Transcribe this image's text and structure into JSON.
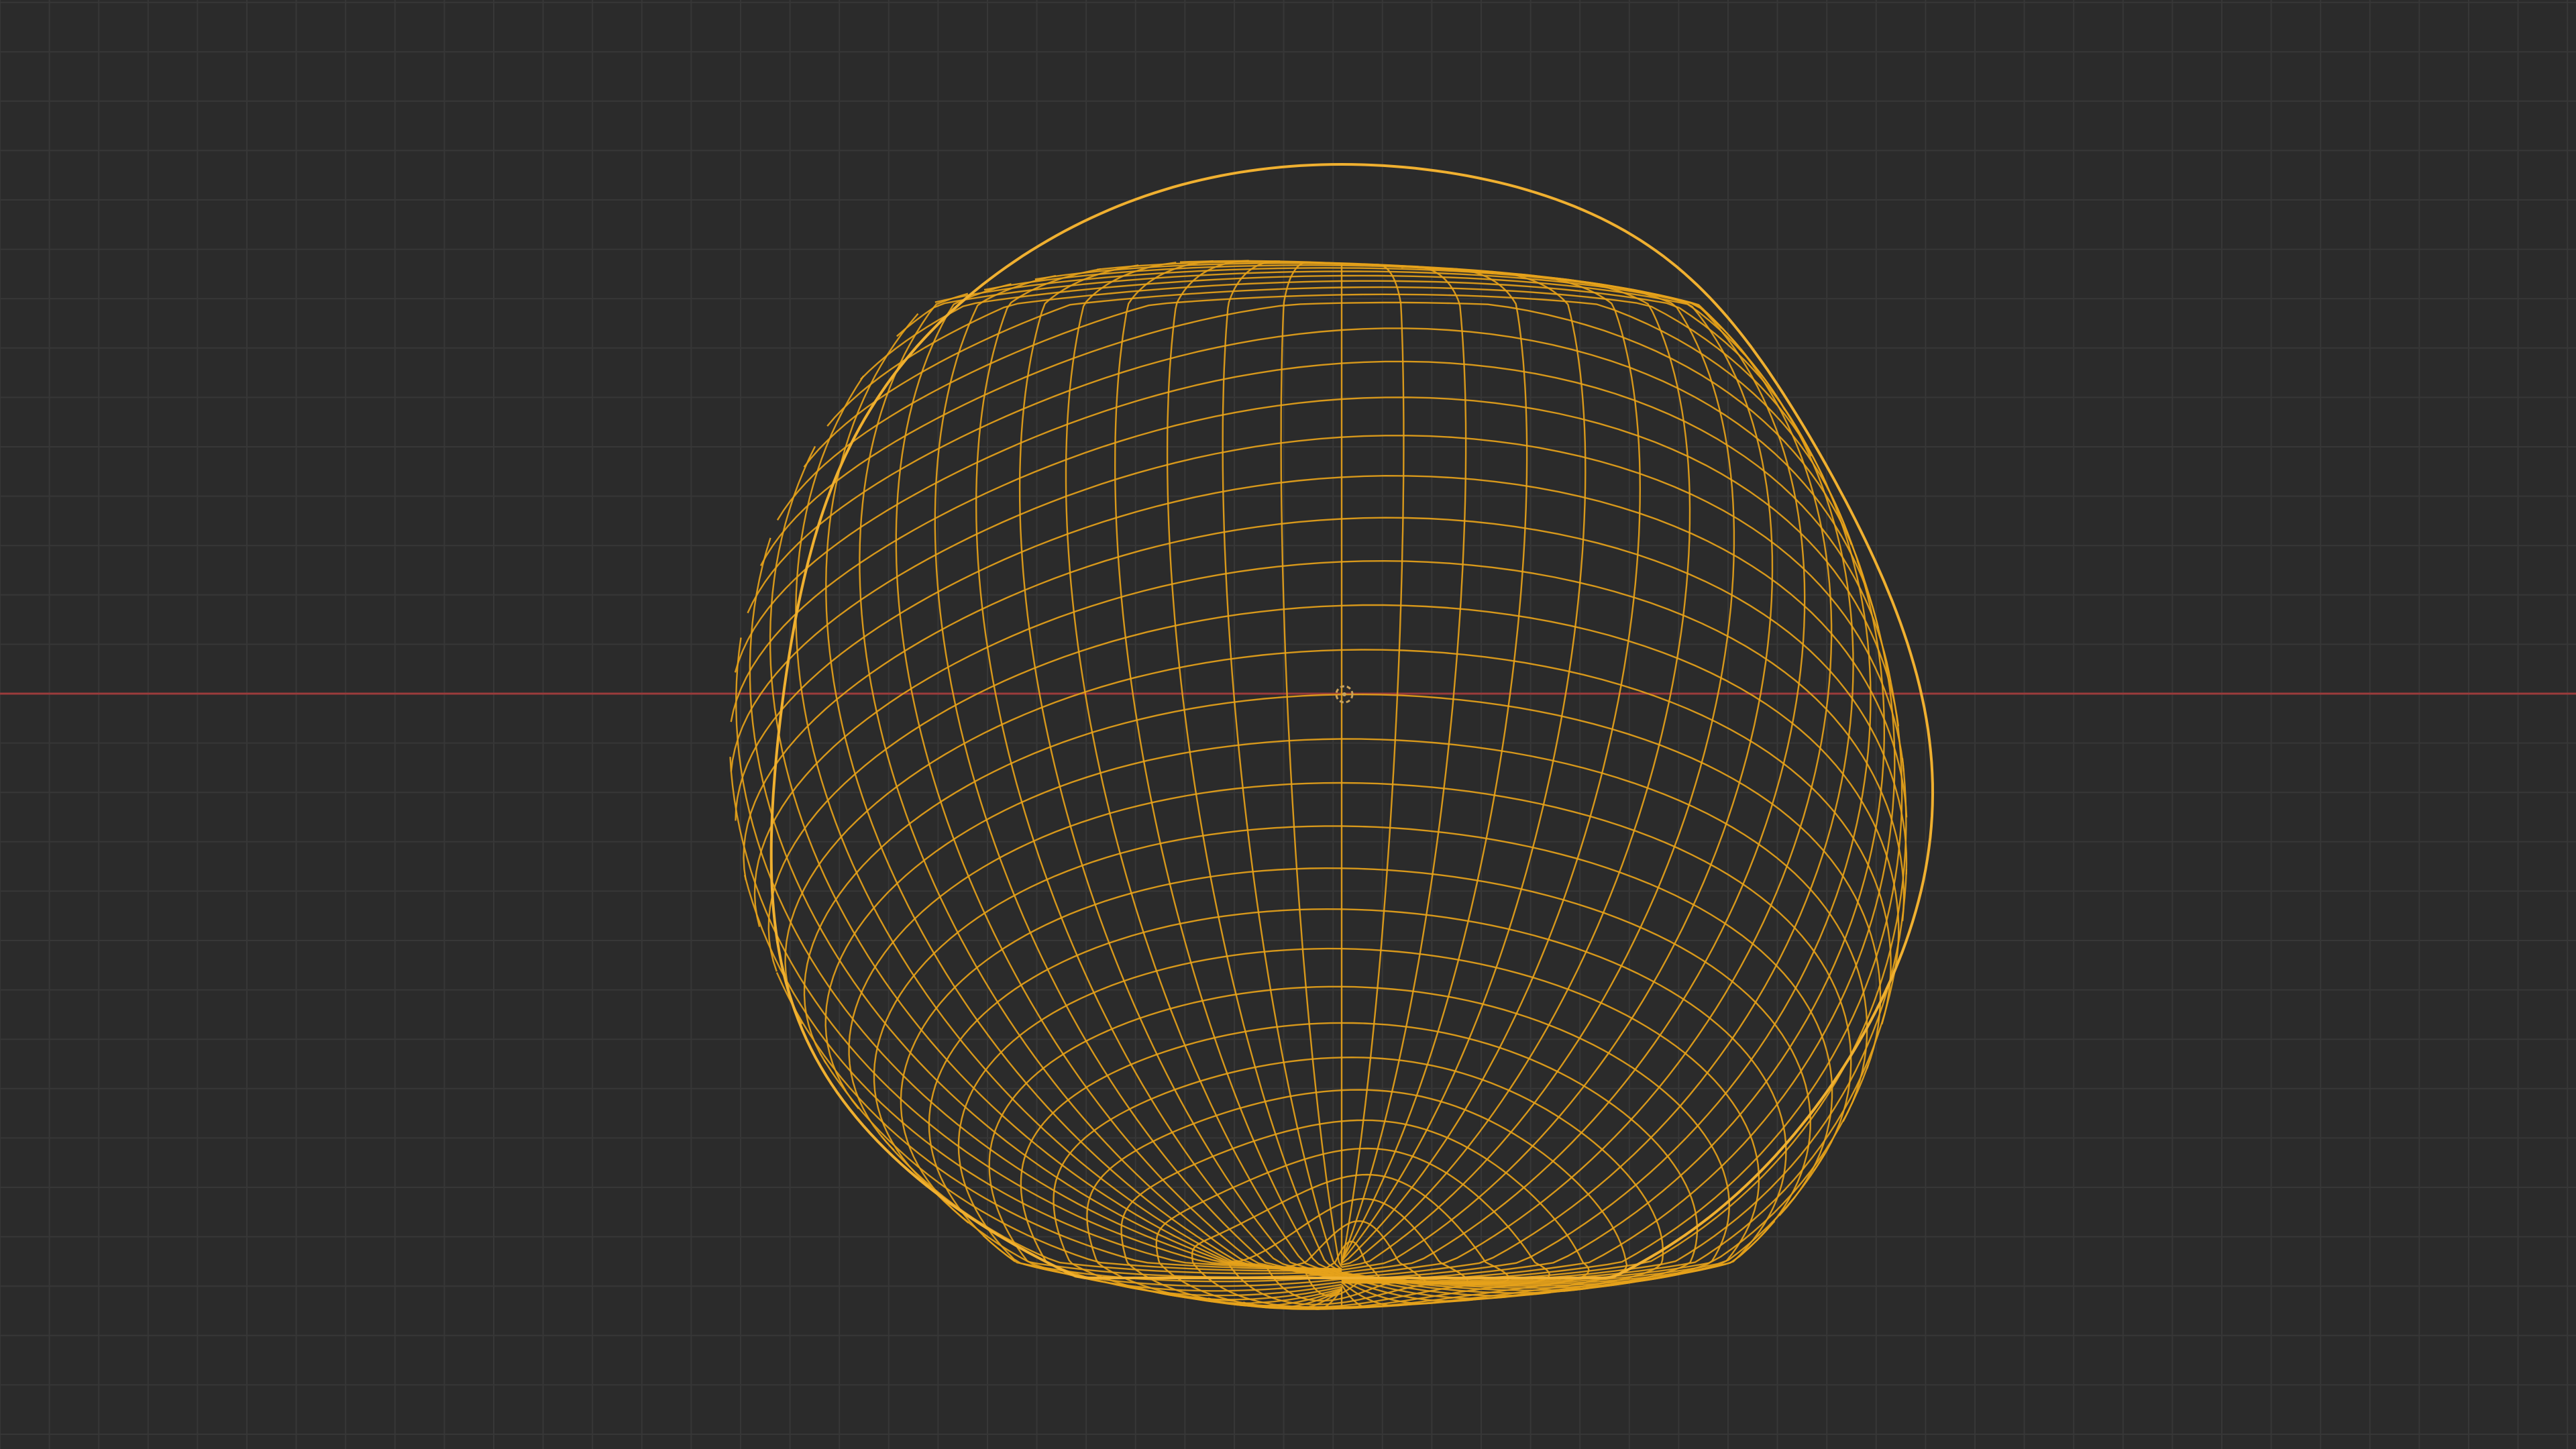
{
  "viewport": {
    "mode": "wireframe",
    "object": "deformed-sphere-mesh",
    "object_selected": true,
    "grid_visible": true,
    "x_axis_visible": true
  },
  "colors": {
    "background": "#2b2b2b",
    "grid_minor": "#373737",
    "grid_major": "#3e3e3e",
    "x_axis": "#9b3b3b",
    "wire_selected": "#e6a21a",
    "wire_outline": "#f0b030",
    "origin_marker": "#c9a25a"
  },
  "icons": {
    "origin": "object-origin-icon"
  }
}
